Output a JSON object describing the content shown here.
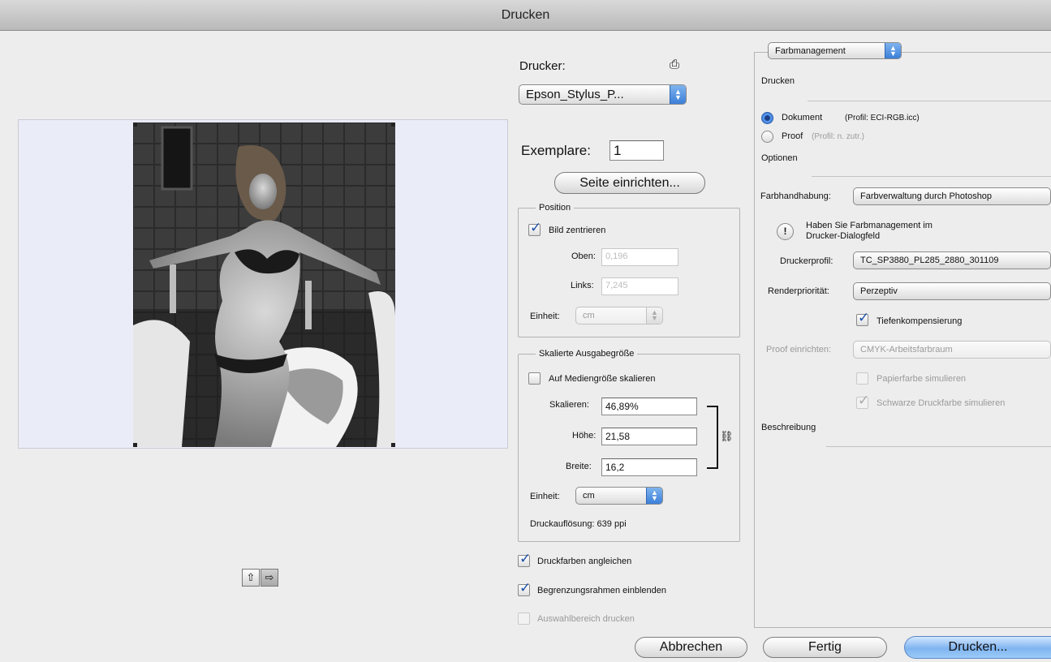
{
  "window": {
    "title": "Drucken"
  },
  "printer": {
    "label": "Drucker:",
    "selected": "Epson_Stylus_P..."
  },
  "copies": {
    "label": "Exemplare:",
    "value": "1"
  },
  "page_setup_button": "Seite einrichten...",
  "position": {
    "legend": "Position",
    "center_label": "Bild zentrieren",
    "center_checked": true,
    "top_label": "Oben:",
    "top_value": "0,196",
    "left_label": "Links:",
    "left_value": "7,245",
    "unit_label": "Einheit:",
    "unit_value": "cm"
  },
  "scaled": {
    "legend": "Skalierte Ausgabegröße",
    "fit_label": "Auf Mediengröße skalieren",
    "fit_checked": false,
    "scale_label": "Skalieren:",
    "scale_value": "46,89%",
    "height_label": "Höhe:",
    "height_value": "21,58",
    "width_label": "Breite:",
    "width_value": "16,2",
    "unit_label": "Einheit:",
    "unit_value": "cm",
    "resolution": "Druckauflösung: 639 ppi"
  },
  "options_bottom": [
    {
      "label": "Druckfarben angleichen",
      "checked": true,
      "enabled": true
    },
    {
      "label": "Begrenzungsrahmen einblenden",
      "checked": true,
      "enabled": true
    },
    {
      "label": "Auswahlbereich drucken",
      "checked": false,
      "enabled": false
    }
  ],
  "color_mgmt": {
    "mode_select": "Farbmanagement",
    "print_heading": "Drucken",
    "document_label": "Dokument",
    "document_profile": "(Profil: ECI-RGB.icc)",
    "proof_label": "Proof",
    "proof_profile": "(Profil: n. zutr.)",
    "options_heading": "Optionen",
    "handling_label": "Farbhandhabung:",
    "handling_value": "Farbverwaltung durch Photoshop",
    "warning_text": "Haben Sie Farbmanagement im Drucker-Dialogfeld",
    "printer_profile_label": "Druckerprofil:",
    "printer_profile_value": "TC_SP3880_PL285_2880_301109",
    "rendering_label": "Renderpriorität:",
    "rendering_value": "Perzeptiv",
    "black_point_label": "Tiefenkompensierung",
    "black_point_checked": true,
    "proof_setup_label": "Proof einrichten:",
    "proof_setup_value": "CMYK-Arbeitsfarbraum",
    "paper_color_label": "Papierfarbe simulieren",
    "black_ink_label": "Schwarze Druckfarbe simulieren",
    "description_heading": "Beschreibung"
  },
  "buttons": {
    "cancel": "Abbrechen",
    "done": "Fertig",
    "print": "Drucken..."
  },
  "icons": {
    "printer_settings": "printer-icon",
    "orientation_portrait": "portrait-orientation-icon",
    "orientation_landscape": "landscape-orientation-icon",
    "link": "chain-link-icon",
    "warning": "exclamation-icon"
  },
  "colors": {
    "accent": "#3b7fd9",
    "preview_bg": "#eaecf8"
  }
}
